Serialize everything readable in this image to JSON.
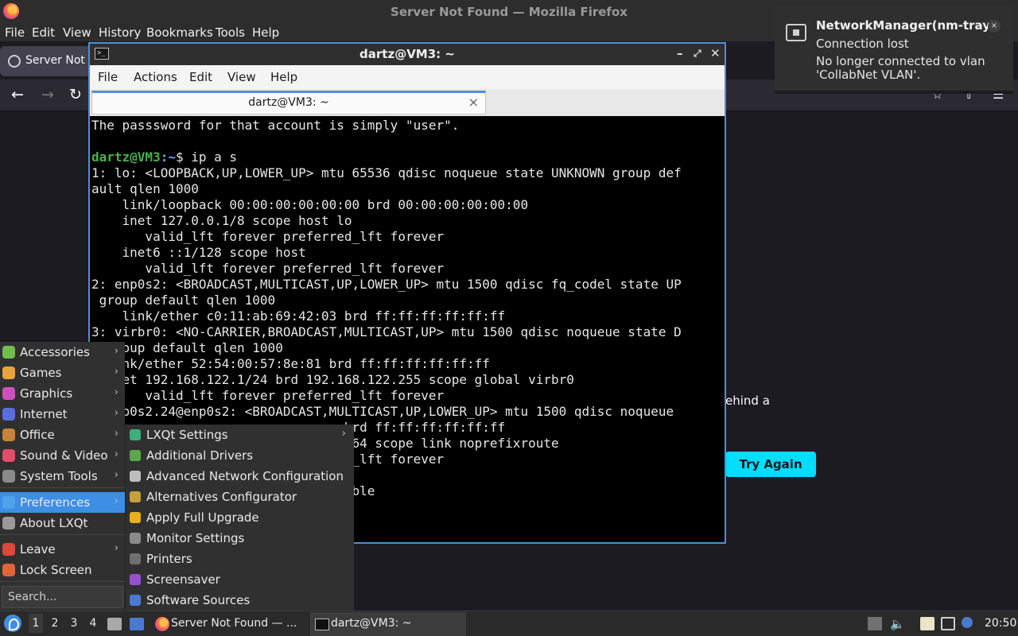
{
  "firefox": {
    "title": "Server Not Found — Mozilla Firefox",
    "menu": [
      "File",
      "Edit",
      "View",
      "History",
      "Bookmarks",
      "Tools",
      "Help"
    ],
    "tab_label": "Server Not F",
    "content_text_fragment": "ehind a",
    "try_again_label": "Try Again"
  },
  "terminal": {
    "title": "dartz@VM3: ~",
    "menu": [
      "File",
      "Actions",
      "Edit",
      "View",
      "Help"
    ],
    "tab_label": "dartz@VM3: ~",
    "prompt_user": "dartz@VM3",
    "prompt_path": ":~",
    "prompt_symbol": "$ ",
    "command": "ip a s",
    "line_before": "The passsword for that account is simply \"user\".",
    "output": [
      "1: lo: <LOOPBACK,UP,LOWER_UP> mtu 65536 qdisc noqueue state UNKNOWN group def",
      "ault qlen 1000",
      "    link/loopback 00:00:00:00:00:00 brd 00:00:00:00:00:00",
      "    inet 127.0.0.1/8 scope host lo",
      "       valid_lft forever preferred_lft forever",
      "    inet6 ::1/128 scope host",
      "       valid_lft forever preferred_lft forever",
      "2: enp0s2: <BROADCAST,MULTICAST,UP,LOWER_UP> mtu 1500 qdisc fq_codel state UP",
      " group default qlen 1000",
      "    link/ether c0:11:ab:69:42:03 brd ff:ff:ff:ff:ff:ff",
      "3: virbr0: <NO-CARRIER,BROADCAST,MULTICAST,UP> mtu 1500 qdisc noqueue state D",
      "  group default qlen 1000",
      "  link/ether 52:54:00:57:8e:81 brd ff:ff:ff:ff:ff:ff",
      "  inet 192.168.122.1/24 brd 192.168.122.255 scope global virbr0",
      "       valid_lft forever preferred_lft forever",
      "  enp0s2.24@enp0s2: <BROADCAST,MULTICAST,UP,LOWER_UP> mtu 1500 qdisc noqueue",
      "                                 brd ff:ff:ff:ff:ff:ff",
      "                                 /64 scope link noprefixroute",
      "                                 d_lft forever",
      "",
      "                                 able"
    ]
  },
  "app_menu": {
    "items": [
      {
        "label": "Accessories",
        "icon": "accessories-icon",
        "color": "#6fbf4a",
        "submenu": true
      },
      {
        "label": "Games",
        "icon": "games-icon",
        "color": "#e8a33a",
        "submenu": true
      },
      {
        "label": "Graphics",
        "icon": "graphics-icon",
        "color": "#d04fc0",
        "submenu": true
      },
      {
        "label": "Internet",
        "icon": "internet-icon",
        "color": "#5b6ee1",
        "submenu": true
      },
      {
        "label": "Office",
        "icon": "office-icon",
        "color": "#c9823a",
        "submenu": true
      },
      {
        "label": "Sound & Video",
        "icon": "sound-video-icon",
        "color": "#e04e6a",
        "submenu": true
      },
      {
        "label": "System Tools",
        "icon": "system-tools-icon",
        "color": "#8a8a8a",
        "submenu": true
      },
      {
        "label": "Preferences",
        "icon": "preferences-icon",
        "color": "#4fa3e8",
        "submenu": true,
        "selected": true
      },
      {
        "label": "About LXQt",
        "icon": "about-icon",
        "color": "#9a9a9a",
        "submenu": false
      },
      {
        "label": "Leave",
        "icon": "leave-icon",
        "color": "#e0463a",
        "submenu": true
      },
      {
        "label": "Lock Screen",
        "icon": "lock-icon",
        "color": "#e0643a",
        "submenu": false
      }
    ],
    "search_placeholder": "Search..."
  },
  "preferences_submenu": {
    "items": [
      {
        "label": "LXQt Settings",
        "icon": "lxqt-settings-icon",
        "color": "#3ab07a",
        "submenu": true
      },
      {
        "label": "Additional Drivers",
        "icon": "drivers-icon",
        "color": "#5aa84a",
        "submenu": false
      },
      {
        "label": "Advanced Network Configuration",
        "icon": "network-config-icon",
        "color": "#bdbdbd",
        "submenu": false
      },
      {
        "label": "Alternatives Configurator",
        "icon": "alternatives-icon",
        "color": "#c8a03a",
        "submenu": false
      },
      {
        "label": "Apply Full Upgrade",
        "icon": "upgrade-icon",
        "color": "#e8b020",
        "submenu": false
      },
      {
        "label": "Monitor Settings",
        "icon": "monitor-icon",
        "color": "#8a8a8a",
        "submenu": false
      },
      {
        "label": "Printers",
        "icon": "printer-icon",
        "color": "#707070",
        "submenu": false
      },
      {
        "label": "Screensaver",
        "icon": "screensaver-icon",
        "color": "#9a4fd0",
        "submenu": false
      },
      {
        "label": "Software Sources",
        "icon": "software-sources-icon",
        "color": "#4a7ad0",
        "submenu": false
      }
    ]
  },
  "notification": {
    "app": "NetworkManager(nm-tray)",
    "summary": "Connection lost",
    "body": "No longer connected to vlan 'CollabNet VLAN'.",
    "close_label": "×"
  },
  "taskbar": {
    "workspaces": [
      "1",
      "2",
      "3",
      "4"
    ],
    "tasks": [
      {
        "label": "Server Not Found — ...",
        "icon": "firefox-icon"
      },
      {
        "label": "dartz@VM3: ~",
        "icon": "terminal-icon"
      }
    ],
    "clock": "20:50"
  }
}
